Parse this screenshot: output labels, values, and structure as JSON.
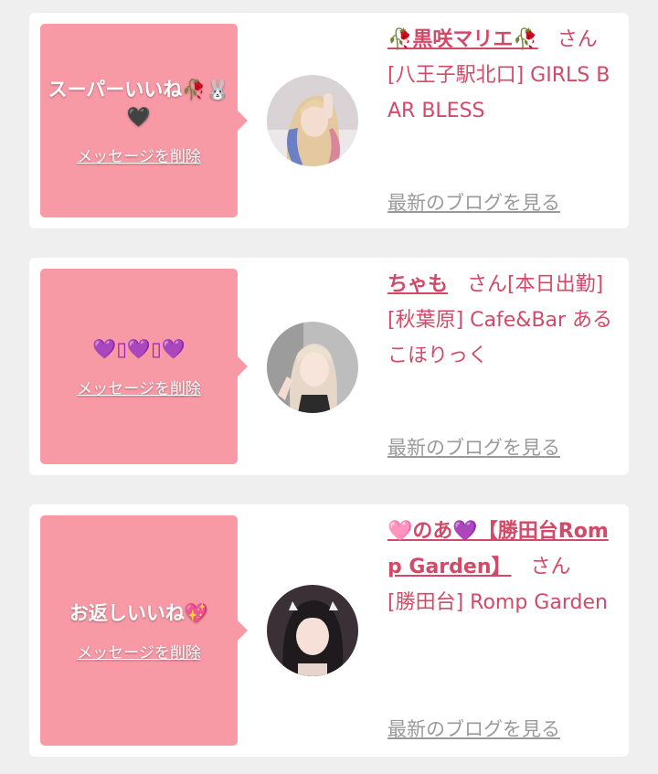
{
  "cards": [
    {
      "message": "スーパーいいね🥀🐰🖤",
      "delete_label": "メッセージを削除",
      "name": "🥀黒咲マリエ🥀",
      "san": "さん",
      "shop": "[八王子駅北口] GIRLS BAR BLESS",
      "blog_label": "最新のブログを見る"
    },
    {
      "message": "💜▯💜▯💜",
      "delete_label": "メッセージを削除",
      "name": "ちゃも",
      "san": "さん[本日出勤]",
      "shop": "[秋葉原] Cafe&Bar あるこほりっく",
      "blog_label": "最新のブログを見る"
    },
    {
      "message": "お返しいいね💖",
      "delete_label": "メッセージを削除",
      "name": "🩷のあ💜【勝田台Romp Garden】",
      "san": "さん",
      "shop": "[勝田台] Romp Garden",
      "blog_label": "最新のブログを見る"
    }
  ],
  "colors": {
    "bubble": "#f79aa6",
    "accent_text": "#d24a67",
    "link_grey": "#9a9a9a",
    "background": "#efefef"
  }
}
